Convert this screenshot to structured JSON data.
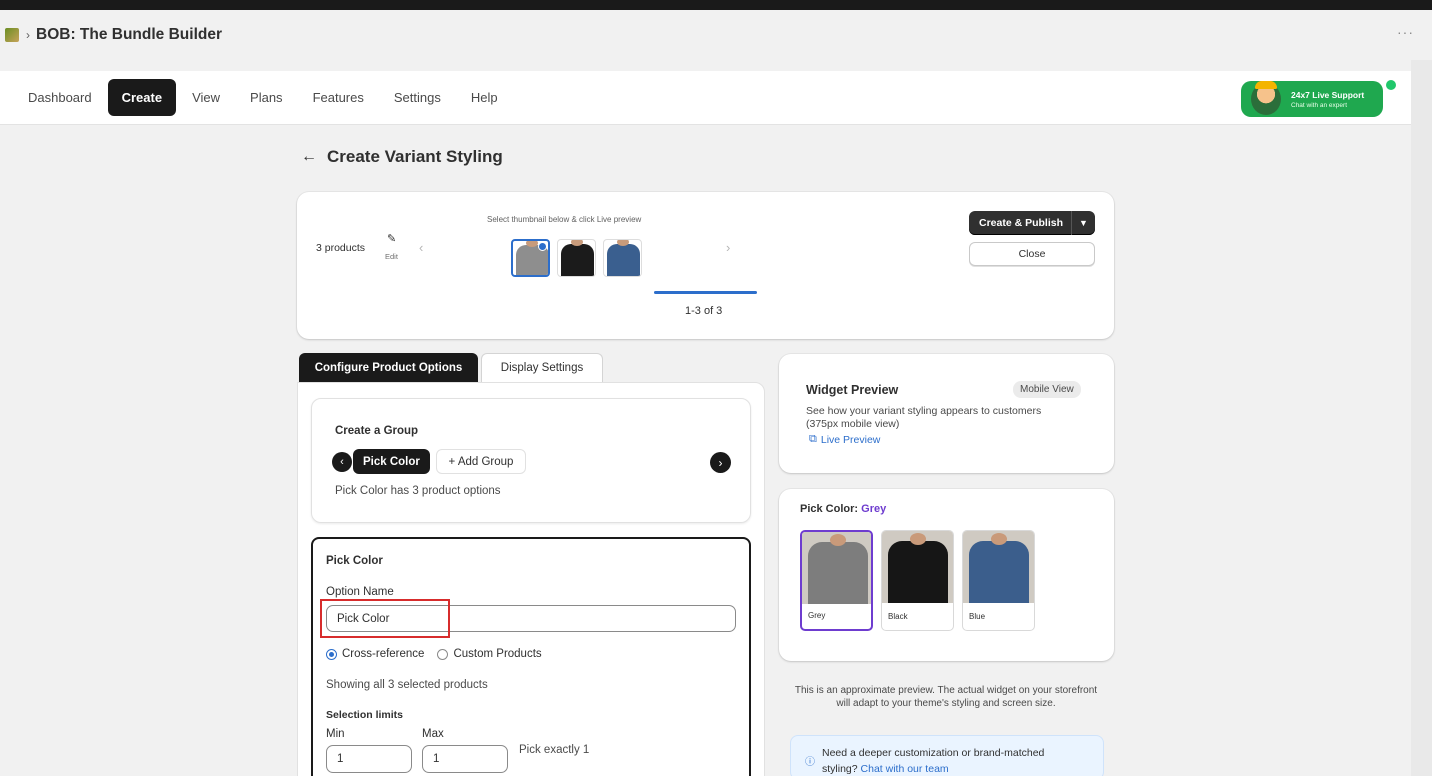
{
  "app": {
    "title": "BOB: The Bundle Builder",
    "separator": "›",
    "more": "···"
  },
  "nav": {
    "items": [
      "Dashboard",
      "Create",
      "View",
      "Plans",
      "Features",
      "Settings",
      "Help"
    ],
    "active": "Create"
  },
  "support": {
    "title": "24x7 Live Support",
    "subtitle": "Chat with an expert"
  },
  "page": {
    "back": "←",
    "title": "Create Variant Styling"
  },
  "products": {
    "count": "3 products",
    "edit_label": "Edit",
    "hint": "Select thumbnail below & click Live preview",
    "range": "1-3 of 3",
    "thumbnails": [
      {
        "color": "#8e8e8e",
        "selected": true
      },
      {
        "color": "#1b1b1b",
        "selected": false
      },
      {
        "color": "#3a5f8f",
        "selected": false
      }
    ],
    "publish_label": "Create & Publish",
    "close_label": "Close"
  },
  "tabs": {
    "configure": "Configure Product Options",
    "display": "Display Settings"
  },
  "group": {
    "title": "Create a Group",
    "chip": "Pick Color",
    "add": "+ Add Group",
    "summary": "Pick Color has 3 product options"
  },
  "option": {
    "title": "Pick Color",
    "name_label": "Option Name",
    "name_value": "Pick Color",
    "radio_cross": "Cross-reference",
    "radio_custom": "Custom Products",
    "showing": "Showing all 3 selected products",
    "limits_title": "Selection limits",
    "min_label": "Min",
    "max_label": "Max",
    "min_value": "1",
    "max_value": "1",
    "pick_exact": "Pick exactly 1"
  },
  "widget": {
    "title": "Widget Preview",
    "badge": "Mobile View",
    "description": "See how your variant styling appears to customers (375px mobile view)",
    "live_preview": "Live Preview"
  },
  "pick_preview": {
    "label": "Pick Color:",
    "value": "Grey",
    "swatches": [
      {
        "name": "Grey",
        "color": "#7d7d7d",
        "selected": true
      },
      {
        "name": "Black",
        "color": "#161616",
        "selected": false
      },
      {
        "name": "Blue",
        "color": "#3b5e8c",
        "selected": false
      }
    ]
  },
  "note": "This is an approximate preview. The actual widget on your storefront will adapt to your theme's styling and screen size.",
  "help": {
    "text": "Need a deeper customization or brand-matched styling?",
    "link": "Chat with our team"
  },
  "colors": {
    "accent": "#2c6ecb",
    "brand_purple": "#6e3ccf",
    "support_green": "#1fa84f",
    "highlight_red": "#d72c2c"
  }
}
